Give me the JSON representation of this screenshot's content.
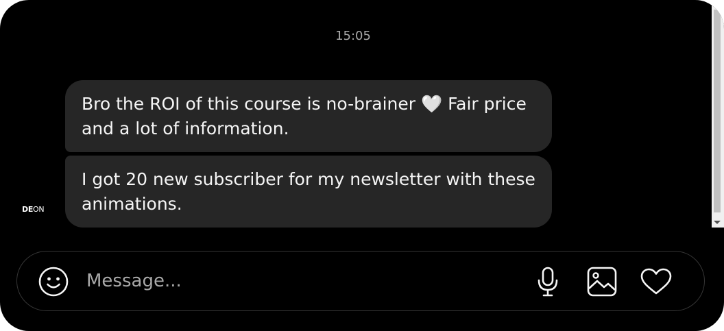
{
  "chat": {
    "timestamp": "15:05",
    "messages": [
      {
        "text": "Bro the ROI of this course is no-brainer 🤍 Fair price and a lot of information."
      },
      {
        "text": "I got 20 new subscriber for my newsletter with these animations."
      }
    ],
    "avatar": {
      "bold": "DE",
      "regular": "ON"
    }
  },
  "composer": {
    "placeholder": "Message...",
    "icons": [
      "emoji-icon",
      "microphone-icon",
      "image-icon",
      "heart-icon"
    ]
  },
  "colors": {
    "background": "#000000",
    "bubble": "#262626",
    "text": "#f5f5f5",
    "muted": "#a8a8a8",
    "border": "#363636"
  }
}
